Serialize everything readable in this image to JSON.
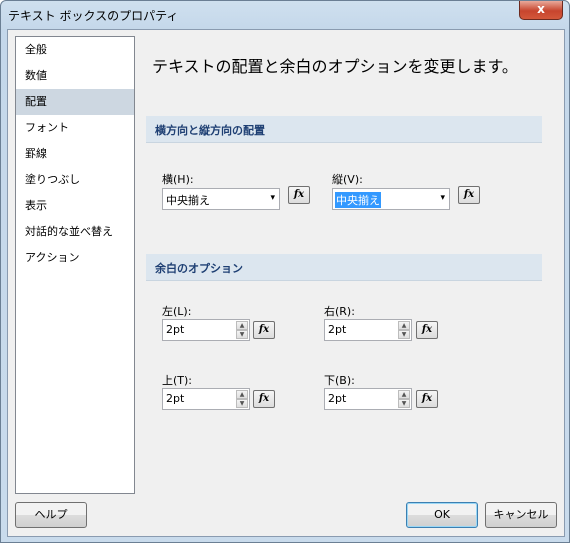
{
  "window": {
    "title": "テキスト ボックスのプロパティ",
    "close_glyph": "x"
  },
  "sidebar": {
    "items": [
      {
        "label": "全般",
        "selected": false
      },
      {
        "label": "数値",
        "selected": false
      },
      {
        "label": "配置",
        "selected": true
      },
      {
        "label": "フォント",
        "selected": false
      },
      {
        "label": "罫線",
        "selected": false
      },
      {
        "label": "塗りつぶし",
        "selected": false
      },
      {
        "label": "表示",
        "selected": false
      },
      {
        "label": "対話的な並べ替え",
        "selected": false
      },
      {
        "label": "アクション",
        "selected": false
      }
    ]
  },
  "main": {
    "heading": "テキストの配置と余白のオプションを変更します。",
    "alignment": {
      "title": "横方向と縦方向の配置",
      "horizontal_label": "横(H):",
      "horizontal_value": "中央揃え",
      "vertical_label": "縦(V):",
      "vertical_value": "中央揃え"
    },
    "padding": {
      "title": "余白のオプション",
      "left_label": "左(L):",
      "left_value": "2pt",
      "right_label": "右(R):",
      "right_value": "2pt",
      "top_label": "上(T):",
      "top_value": "2pt",
      "bottom_label": "下(B):",
      "bottom_value": "2pt"
    },
    "fx_glyph": "fx"
  },
  "footer": {
    "help": "ヘルプ",
    "ok": "OK",
    "cancel": "キャンセル"
  },
  "icons": {
    "dropdown": "▾",
    "spin_up": "▲",
    "spin_down": "▼"
  }
}
